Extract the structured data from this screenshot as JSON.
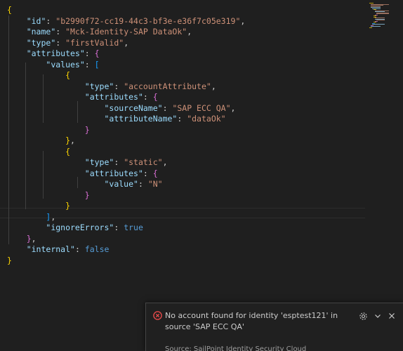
{
  "editor": {
    "lines": [
      [
        {
          "c": "brk1",
          "t": "{"
        }
      ],
      [
        {
          "c": "punc",
          "t": "    "
        },
        {
          "c": "key",
          "t": "\"id\""
        },
        {
          "c": "punc",
          "t": ": "
        },
        {
          "c": "str",
          "t": "\"b2990f72-cc19-44c3-bf3e-e36f7c05e319\""
        },
        {
          "c": "punc",
          "t": ","
        }
      ],
      [
        {
          "c": "punc",
          "t": "    "
        },
        {
          "c": "key",
          "t": "\"name\""
        },
        {
          "c": "punc",
          "t": ": "
        },
        {
          "c": "str",
          "t": "\"Mck-Identity-SAP DataOk\""
        },
        {
          "c": "punc",
          "t": ","
        }
      ],
      [
        {
          "c": "punc",
          "t": "    "
        },
        {
          "c": "key",
          "t": "\"type\""
        },
        {
          "c": "punc",
          "t": ": "
        },
        {
          "c": "str",
          "t": "\"firstValid\""
        },
        {
          "c": "punc",
          "t": ","
        }
      ],
      [
        {
          "c": "punc",
          "t": "    "
        },
        {
          "c": "key",
          "t": "\"attributes\""
        },
        {
          "c": "punc",
          "t": ": "
        },
        {
          "c": "brk2",
          "t": "{"
        }
      ],
      [
        {
          "c": "punc",
          "t": "        "
        },
        {
          "c": "key",
          "t": "\"values\""
        },
        {
          "c": "punc",
          "t": ": "
        },
        {
          "c": "brk3",
          "t": "["
        }
      ],
      [
        {
          "c": "punc",
          "t": "            "
        },
        {
          "c": "brk1",
          "t": "{"
        }
      ],
      [
        {
          "c": "punc",
          "t": "                "
        },
        {
          "c": "key",
          "t": "\"type\""
        },
        {
          "c": "punc",
          "t": ": "
        },
        {
          "c": "str",
          "t": "\"accountAttribute\""
        },
        {
          "c": "punc",
          "t": ","
        }
      ],
      [
        {
          "c": "punc",
          "t": "                "
        },
        {
          "c": "key",
          "t": "\"attributes\""
        },
        {
          "c": "punc",
          "t": ": "
        },
        {
          "c": "brk2",
          "t": "{"
        }
      ],
      [
        {
          "c": "punc",
          "t": "                    "
        },
        {
          "c": "key",
          "t": "\"sourceName\""
        },
        {
          "c": "punc",
          "t": ": "
        },
        {
          "c": "str",
          "t": "\"SAP ECC QA\""
        },
        {
          "c": "punc",
          "t": ","
        }
      ],
      [
        {
          "c": "punc",
          "t": "                    "
        },
        {
          "c": "key",
          "t": "\"attributeName\""
        },
        {
          "c": "punc",
          "t": ": "
        },
        {
          "c": "str",
          "t": "\"dataOk\""
        }
      ],
      [
        {
          "c": "punc",
          "t": "                "
        },
        {
          "c": "brk2",
          "t": "}"
        }
      ],
      [
        {
          "c": "punc",
          "t": "            "
        },
        {
          "c": "brk1",
          "t": "}"
        },
        {
          "c": "punc",
          "t": ","
        }
      ],
      [
        {
          "c": "punc",
          "t": "            "
        },
        {
          "c": "brk1",
          "t": "{"
        }
      ],
      [
        {
          "c": "punc",
          "t": "                "
        },
        {
          "c": "key",
          "t": "\"type\""
        },
        {
          "c": "punc",
          "t": ": "
        },
        {
          "c": "str",
          "t": "\"static\""
        },
        {
          "c": "punc",
          "t": ","
        }
      ],
      [
        {
          "c": "punc",
          "t": "                "
        },
        {
          "c": "key",
          "t": "\"attributes\""
        },
        {
          "c": "punc",
          "t": ": "
        },
        {
          "c": "brk2",
          "t": "{"
        }
      ],
      [
        {
          "c": "punc",
          "t": "                    "
        },
        {
          "c": "key",
          "t": "\"value\""
        },
        {
          "c": "punc",
          "t": ": "
        },
        {
          "c": "str",
          "t": "\"N\""
        }
      ],
      [
        {
          "c": "punc",
          "t": "                "
        },
        {
          "c": "brk2",
          "t": "}"
        }
      ],
      [
        {
          "c": "punc",
          "t": "            "
        },
        {
          "c": "brk1",
          "t": "}"
        }
      ],
      [
        {
          "c": "punc",
          "t": "        "
        },
        {
          "c": "brk3",
          "t": "]"
        },
        {
          "c": "punc",
          "t": ","
        }
      ],
      [
        {
          "c": "punc",
          "t": "        "
        },
        {
          "c": "key",
          "t": "\"ignoreErrors\""
        },
        {
          "c": "punc",
          "t": ": "
        },
        {
          "c": "kw",
          "t": "true"
        }
      ],
      [
        {
          "c": "punc",
          "t": "    "
        },
        {
          "c": "brk2",
          "t": "}"
        },
        {
          "c": "punc",
          "t": ","
        }
      ],
      [
        {
          "c": "punc",
          "t": "    "
        },
        {
          "c": "key",
          "t": "\"internal\""
        },
        {
          "c": "punc",
          "t": ": "
        },
        {
          "c": "kw",
          "t": "false"
        }
      ],
      [
        {
          "c": "brk1",
          "t": "}"
        }
      ]
    ]
  },
  "notification": {
    "icon": "error-icon",
    "message": "No account found for identity 'esptest121' in source 'SAP ECC QA'",
    "source": "Source: SailPoint Identity Security Cloud",
    "actions": [
      "gear-icon",
      "chevron-down-icon",
      "close-icon"
    ]
  },
  "colors": {
    "background": "#1f1f1f",
    "json_key": "#9cdcfe",
    "json_string": "#ce9178",
    "json_keyword": "#569cd6",
    "bracket_level1": "#ffd700",
    "bracket_level2": "#da70d6",
    "bracket_level3": "#179fff",
    "error": "#f14c4c"
  }
}
